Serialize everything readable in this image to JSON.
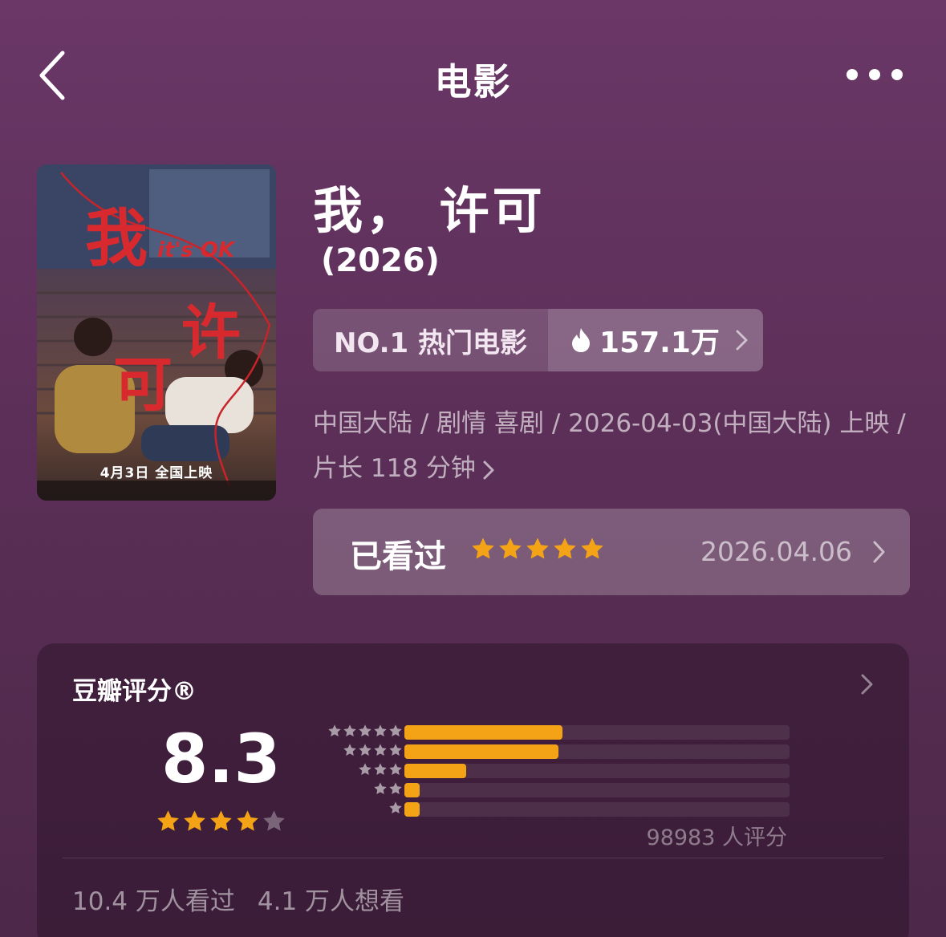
{
  "nav": {
    "title": "电影"
  },
  "poster": {
    "title_line_1": "我",
    "title_line_2": "许",
    "title_line_3": "可",
    "subtitle_en": "it's OK",
    "release_text": "4月3日 全国上映"
  },
  "movie": {
    "title": "我， 许可",
    "year": "(2026)"
  },
  "rank": {
    "label": "NO.1 热门电影",
    "heat": "157.1万"
  },
  "meta": {
    "line": "中国大陆 / 剧情 喜剧 / 2026-04-03(中国大陆) 上映 / 片长 118 分钟"
  },
  "watched": {
    "label": "已看过",
    "stars": 5,
    "date": "2026.04.06"
  },
  "rating": {
    "title": "豆瓣评分®",
    "score": "8.3",
    "score_stars": 4,
    "distribution": [
      {
        "stars": 5,
        "fraction": 0.41
      },
      {
        "stars": 4,
        "fraction": 0.4
      },
      {
        "stars": 3,
        "fraction": 0.16
      },
      {
        "stars": 2,
        "fraction": 0.04
      },
      {
        "stars": 1,
        "fraction": 0.04
      }
    ],
    "count_text": "98983 人评分",
    "watched_count": "10.4 万人看过",
    "want_count": "4.1 万人想看"
  },
  "colors": {
    "accent_star": "#f5a316",
    "empty_star": "#7a6478",
    "dist_star": "#a89aa6"
  }
}
